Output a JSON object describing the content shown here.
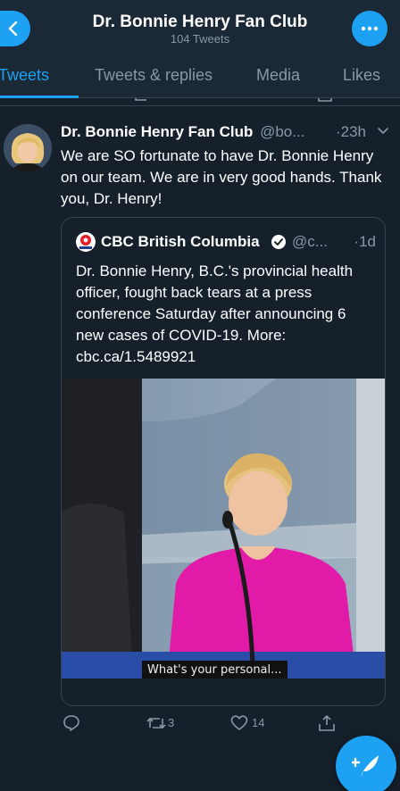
{
  "header": {
    "title": "Dr. Bonnie Henry Fan Club",
    "subtitle": "104 Tweets"
  },
  "tabs": [
    {
      "label": "Tweets",
      "active": true
    },
    {
      "label": "Tweets & replies",
      "active": false
    },
    {
      "label": "Media",
      "active": false
    },
    {
      "label": "Likes",
      "active": false
    }
  ],
  "tweet": {
    "author_name": "Dr. Bonnie Henry Fan Club",
    "author_handle": "@bo...",
    "time": "·23h",
    "text": "We are SO fortunate to have Dr. Bonnie Henry on our team. We are in very good hands. Thank you, Dr. Henry!",
    "quoted": {
      "author_name": "CBC British Columbia",
      "author_handle": "@c...",
      "time": "·1d",
      "text": "Dr. Bonnie Henry, B.C.'s provincial health officer, fought back tears at a press conference Saturday after announcing 6 new cases of COVID-19. More: cbc.ca/1.5489921",
      "video_caption": "What's your personal..."
    },
    "actions": {
      "retweets": "3",
      "likes": "14"
    }
  },
  "colors": {
    "background": "#15202b",
    "header": "#1b2836",
    "accent": "#1da1f2",
    "secondary_text": "#8899a6",
    "border": "#38444d"
  },
  "icons": [
    "back-arrow-icon",
    "more-dots-icon",
    "chevron-down-icon",
    "verified-badge-icon",
    "reply-icon",
    "retweet-icon",
    "like-heart-icon",
    "share-icon",
    "compose-feather-icon"
  ]
}
